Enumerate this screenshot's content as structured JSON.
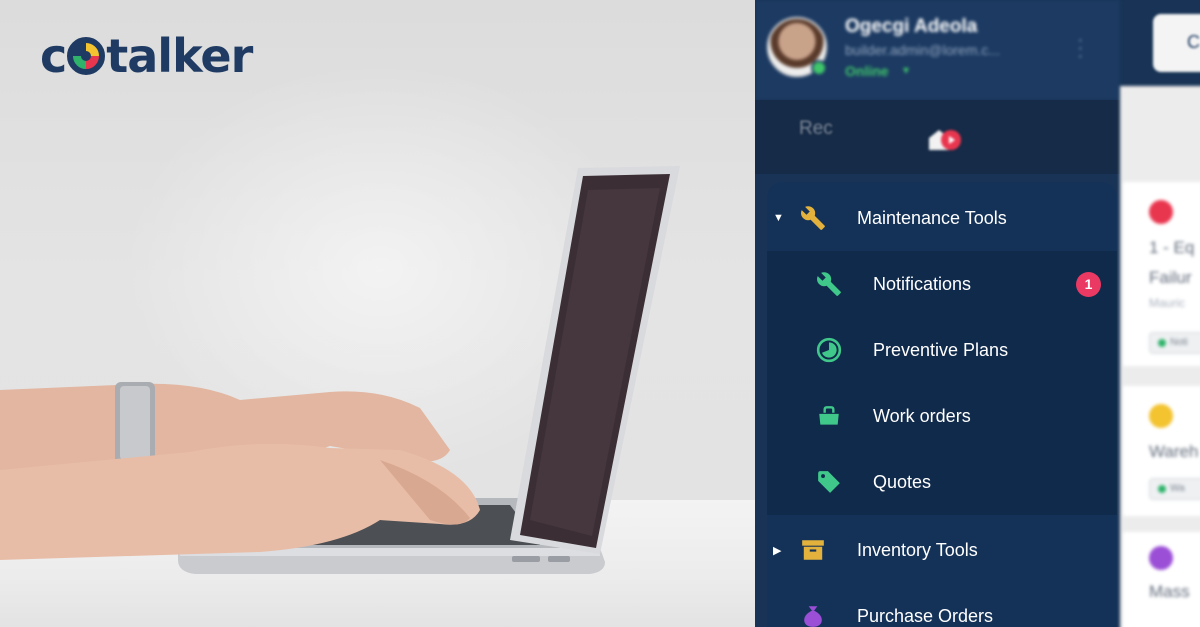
{
  "brand": {
    "logo_text": "talker",
    "logo_letter": "c"
  },
  "user": {
    "name": "Ogecgi Adeola",
    "email": "builder.admin@lorem.c...",
    "status": "Online"
  },
  "top_button_label": "C",
  "menu": {
    "maintenance": {
      "label": "Maintenance Tools",
      "icon": "wrench-icon",
      "expanded": true
    },
    "children": [
      {
        "label": "Notifications",
        "icon": "wrench-icon",
        "badge": "1"
      },
      {
        "label": "Preventive Plans",
        "icon": "timer-icon"
      },
      {
        "label": "Work orders",
        "icon": "toolbox-icon"
      },
      {
        "label": "Quotes",
        "icon": "tag-icon"
      }
    ],
    "inventory": {
      "label": "Inventory Tools",
      "icon": "archive-box-icon",
      "expanded": false
    },
    "purchase": {
      "label": "Purchase Orders",
      "icon": "money-bag-icon"
    }
  },
  "cards_panel": {
    "title": "Rec",
    "cards": [
      {
        "line1": "1 - Eq",
        "line2": "Failur",
        "sub": "Mauric",
        "chip": "Noti",
        "dot_color": "#e9364f",
        "chip_color": "#2fb36a"
      },
      {
        "line1": "Wareh",
        "chip": "Wa",
        "dot_color": "#f3c330",
        "chip_color": "#2fb36a"
      },
      {
        "line1": "Mass",
        "dot_color": "#9b4fd6"
      }
    ]
  },
  "colors": {
    "navy": "#183355",
    "menu_bg": "#143258",
    "accent_green": "#3fc56a",
    "badge_red": "#ea3a63",
    "icon_gold": "#e3b23c",
    "icon_green": "#3fc88a",
    "icon_purple": "#9b4fd6"
  }
}
